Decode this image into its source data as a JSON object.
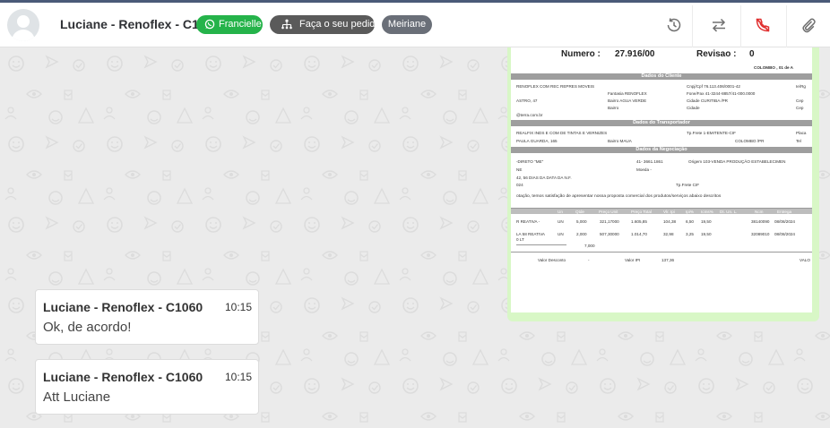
{
  "header": {
    "contact_name": "Luciane - Renoflex - C1060",
    "tags": [
      {
        "label": "Francielle",
        "color": "#25b34a",
        "icon": "whatsapp-icon"
      },
      {
        "label": "Faça o seu pedido",
        "color": "#5a5a5a",
        "icon": "flow-icon"
      },
      {
        "label": "Meiriane",
        "color": "#6a6f78"
      }
    ],
    "actions": [
      {
        "name": "history-icon"
      },
      {
        "name": "transfer-icon"
      },
      {
        "name": "end-call-icon",
        "color": "#e03030"
      },
      {
        "name": "attach-icon"
      }
    ]
  },
  "document": {
    "numero_label": "Numero :",
    "numero_value": "27.916/00",
    "revisao_label": "Revisao :",
    "revisao_value": "0",
    "place_date": "COLOMBO      , 01 de A",
    "sections": {
      "cliente": "Dados do Cliente",
      "transportador": "Dados do Transportador",
      "negociacao": "Dados da Negociação"
    },
    "lines": [
      "RENOFLEX COM REC REPRES MOVEIS",
      "Cnpj/Cpf      76.113.406/0001-42",
      "Ie/Rg",
      "Fantasia   RENOFLEX",
      "Fone/Fax      41-3244-8857/41-000.0000",
      "ASTRO, 47",
      "Bairro    AGUA VERDE",
      "Cidade     CURITIBA      /PR",
      "Cep",
      "Bairro",
      "Cidade",
      "Cep",
      "@terra.com.br",
      "REALFIX INDS E COM DE TINTAS E VERNIZES",
      "Tp.Frete      1-EMITENTE-CIF",
      "Placa",
      "PAULA GUARDA, 165",
      "Bairro    MAUA",
      "COLOMBO      /PR",
      "Tel",
      "-DIRETO \"ME\"",
      "41- 3661.1861",
      "Origem      103-VENDA PRODUÇÃO ESTABELECIMEN",
      "NE",
      "Moeda     -",
      "42, 56 DIAS DA DATA DA N.F.",
      "024",
      "Tp.Frete      CIF",
      "otação, temos satisfação de apresentar nossa proposta comercial dos produtos/serviços abaixo descritos"
    ],
    "table_header": [
      "Un",
      "Qtde",
      "Preço Unit",
      "Preço Total",
      "Vlr. Ipi",
      "Ipi%",
      "Icms%",
      "Dt. Un. L.",
      "Ncm",
      "Entrega"
    ],
    "rows": [
      [
        "R REATIVA -",
        "UN",
        "5,000",
        "321,17000",
        "1.605,85",
        "104,38",
        "6,50",
        "19,50",
        "38140090",
        "08/08/2024"
      ],
      [
        "LA 58 REATIVA",
        "UN",
        "2,000",
        "507,30000",
        "1.014,70",
        "32,98",
        "3,25",
        "19,50",
        "32089010",
        "08/08/2024"
      ]
    ],
    "row2_extra": "0 LT",
    "total_qty": "7,000",
    "footer": {
      "desconto_label": "Valor Desconto",
      "desconto_value": "-",
      "ipi_label": "Valor IPI",
      "ipi_value": "137,36",
      "valor": "VALO"
    }
  },
  "messages": [
    {
      "sender": "Luciane - Renoflex - C1060",
      "time": "10:15",
      "text": "Ok, de acordo!"
    },
    {
      "sender": "Luciane - Renoflex - C1060",
      "time": "10:15",
      "text": "Att Luciane"
    }
  ]
}
